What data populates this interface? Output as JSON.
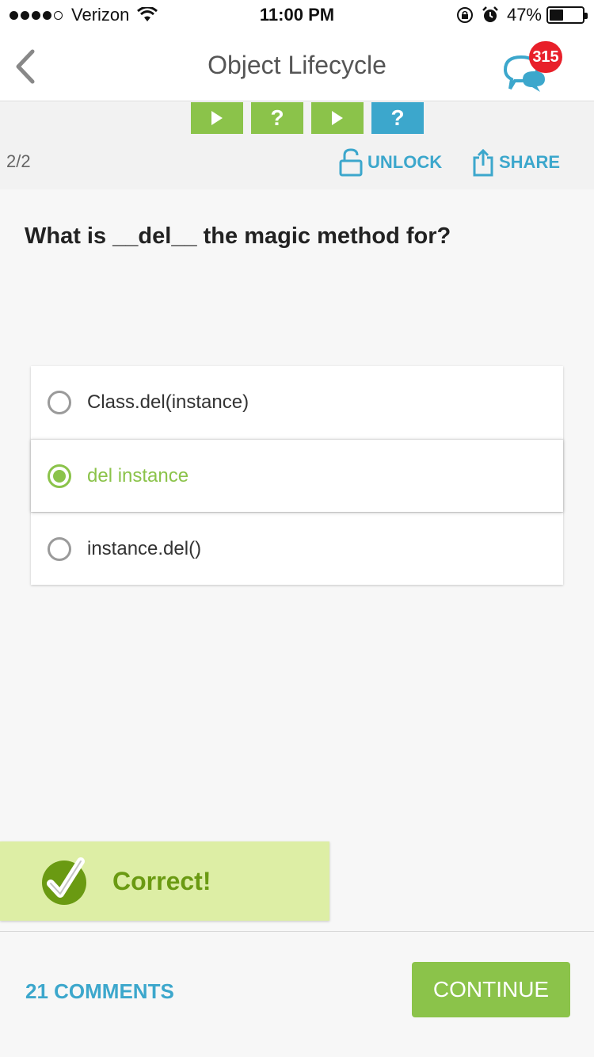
{
  "status_bar": {
    "carrier": "Verizon",
    "time": "11:00 PM",
    "battery_percent": "47%",
    "battery_level": 0.47,
    "signal_bars_filled": 4,
    "signal_bars_total": 5,
    "icons": [
      "wifi-icon",
      "rotation-lock-icon",
      "alarm-icon",
      "battery-icon"
    ]
  },
  "nav": {
    "title": "Object Lifecycle",
    "back_icon": "chevron-left-icon",
    "chat_icon": "chat-bubbles-icon",
    "chat_badge": "315"
  },
  "progress": {
    "steps": [
      {
        "type": "lesson",
        "symbol": "▶",
        "color": "#8bc34a"
      },
      {
        "type": "quiz",
        "symbol": "?",
        "color": "#8bc34a"
      },
      {
        "type": "lesson",
        "symbol": "▶",
        "color": "#8bc34a"
      },
      {
        "type": "quiz",
        "symbol": "?",
        "color": "#3ca7cc"
      }
    ]
  },
  "toolbar": {
    "counter": "2/2",
    "unlock_label": "UNLOCK",
    "share_label": "SHARE"
  },
  "question": {
    "text": "What is __del__ the magic method for?"
  },
  "answers": [
    {
      "text": "Class.del(instance)",
      "selected": false
    },
    {
      "text": "del instance",
      "selected": true
    },
    {
      "text": "instance.del()",
      "selected": false
    }
  ],
  "result": {
    "text": "Correct!",
    "icon": "checkmark-icon"
  },
  "footer": {
    "comments_label": "21 COMMENTS",
    "continue_label": "CONTINUE"
  },
  "colors": {
    "accent_green": "#8bc34a",
    "accent_blue": "#3ca7cc",
    "badge_red": "#e8202a",
    "correct_bg": "#ddeea5",
    "correct_text": "#6a9a12"
  }
}
